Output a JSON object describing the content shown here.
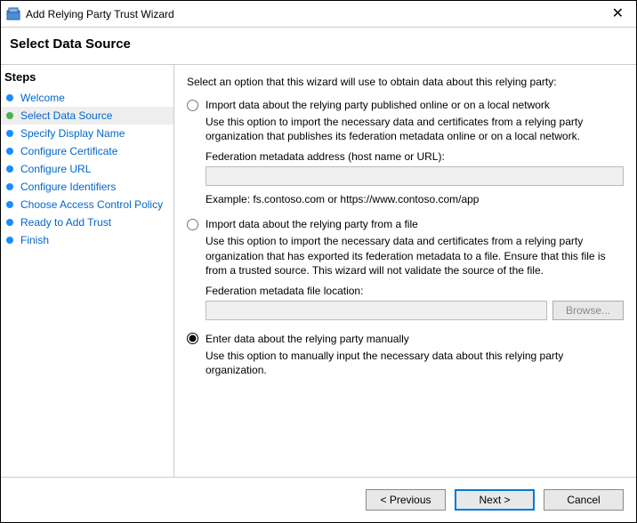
{
  "window": {
    "title": "Add Relying Party Trust Wizard"
  },
  "header": {
    "title": "Select Data Source"
  },
  "sidebar": {
    "steps_label": "Steps",
    "items": [
      {
        "label": "Welcome"
      },
      {
        "label": "Select Data Source"
      },
      {
        "label": "Specify Display Name"
      },
      {
        "label": "Configure Certificate"
      },
      {
        "label": "Configure URL"
      },
      {
        "label": "Configure Identifiers"
      },
      {
        "label": "Choose Access Control Policy"
      },
      {
        "label": "Ready to Add Trust"
      },
      {
        "label": "Finish"
      }
    ]
  },
  "main": {
    "intro": "Select an option that this wizard will use to obtain data about this relying party:",
    "opt1": {
      "label": "Import data about the relying party published online or on a local network",
      "desc": "Use this option to import the necessary data and certificates from a relying party organization that publishes its federation metadata online or on a local network.",
      "field_label": "Federation metadata address (host name or URL):",
      "value": "",
      "example": "Example: fs.contoso.com or https://www.contoso.com/app"
    },
    "opt2": {
      "label": "Import data about the relying party from a file",
      "desc": "Use this option to import the necessary data and certificates from a relying party organization that has exported its federation metadata to a file. Ensure that this file is from a trusted source.  This wizard will not validate the source of the file.",
      "field_label": "Federation metadata file location:",
      "value": "",
      "browse": "Browse..."
    },
    "opt3": {
      "label": "Enter data about the relying party manually",
      "desc": "Use this option to manually input the necessary data about this relying party organization."
    }
  },
  "footer": {
    "previous": "< Previous",
    "next": "Next >",
    "cancel": "Cancel"
  }
}
